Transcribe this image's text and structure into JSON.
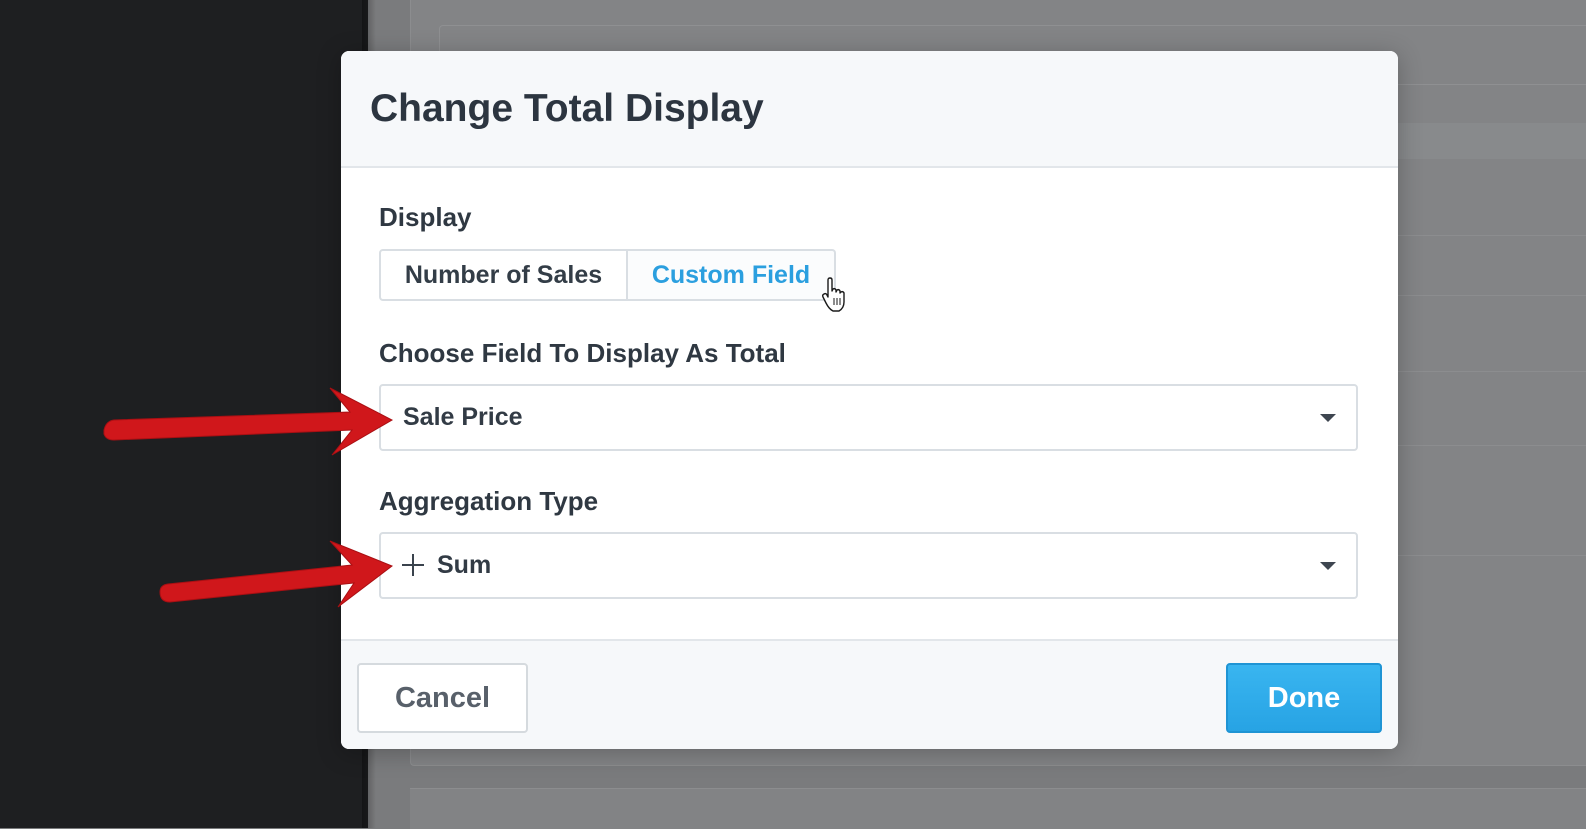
{
  "modal": {
    "title": "Change Total Display"
  },
  "display": {
    "label": "Display",
    "options": [
      {
        "label": "Number of Sales",
        "selected": false
      },
      {
        "label": "Custom Field",
        "selected": true
      }
    ]
  },
  "field_select": {
    "label": "Choose Field To Display As Total",
    "value": "Sale Price"
  },
  "aggregation_select": {
    "label": "Aggregation Type",
    "value": "Sum",
    "icon": "plus-icon"
  },
  "footer": {
    "cancel_label": "Cancel",
    "done_label": "Done"
  },
  "colors": {
    "accent": "#2b9fdf",
    "primary_button": "#2ba7e8",
    "annotation_arrow": "#d0171b",
    "title_text": "#2c3540"
  }
}
